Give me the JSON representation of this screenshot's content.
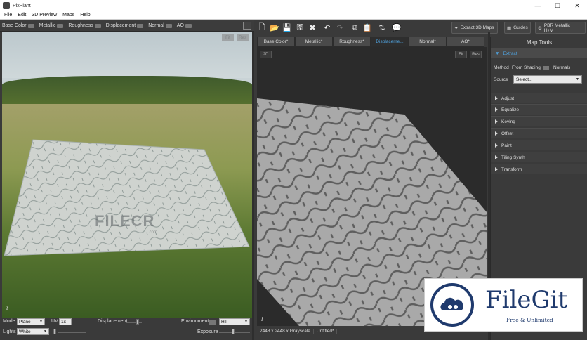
{
  "window": {
    "title": "PixPlant",
    "minimize": "—",
    "maximize": "☐",
    "close": "✕"
  },
  "menu": [
    "File",
    "Edit",
    "3D Preview",
    "Maps",
    "Help"
  ],
  "left_toolbar": {
    "channels": [
      "Base Color",
      "Metallic",
      "Roughness",
      "Displacement",
      "Normal",
      "AO"
    ]
  },
  "view3d": {
    "fit": "Fit",
    "res": "Res",
    "watermark": "FILECR",
    "watermark_sub": ".com"
  },
  "bottom3d": {
    "mode_label": "Mode",
    "mode_value": "Plane",
    "uv_label": "UV",
    "uv_value": "1x",
    "displacement_label": "Displacement",
    "environment_label": "Environment",
    "environment_value": "Hill",
    "lights_label": "Lights",
    "lights_value": "White",
    "exposure_label": "Exposure"
  },
  "toolbar": {
    "extract_label": "Extract 3D Maps",
    "guides_label": "Guides",
    "preset_label": "PBR Metallic | H+V"
  },
  "tabs": [
    "Base Color*",
    "Metallic*",
    "Roughness*",
    "Displaceme...",
    "Normal*",
    "AO*"
  ],
  "active_tab": 3,
  "view2d": {
    "btn_2d": "2D",
    "fit": "Fit",
    "res": "Res"
  },
  "status": {
    "dimensions": "2448 x 2448 x Grayscale",
    "file": "Untitled*"
  },
  "map_tools": {
    "title": "Map Tools",
    "extract_section": "Extract",
    "method_label": "Method",
    "method_a": "From Shading",
    "method_b": "Normals",
    "source_label": "Source",
    "source_value": "Select...",
    "sections": [
      "Adjust",
      "Equalize",
      "Keying",
      "Offset",
      "Paint",
      "Tiling Synth",
      "Transform"
    ]
  },
  "watermark": {
    "brand": "FileGit",
    "tagline": "Free & Unlimited"
  },
  "colors": {
    "accent": "#4fa3e0",
    "panel": "#3a3a3a",
    "brand": "#1f3a6d"
  }
}
